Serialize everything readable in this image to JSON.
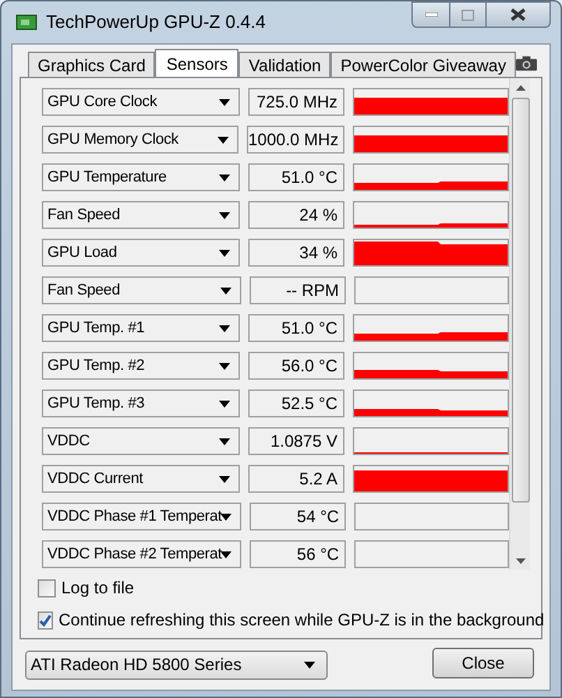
{
  "window": {
    "title": "TechPowerUp GPU-Z 0.4.4"
  },
  "tabs": [
    {
      "label": "Graphics Card",
      "selected": false
    },
    {
      "label": "Sensors",
      "selected": true
    },
    {
      "label": "Validation",
      "selected": false
    },
    {
      "label": "PowerColor Giveaway",
      "selected": false
    }
  ],
  "sensors": [
    {
      "name": "GPU Core Clock",
      "reading": "725.0 MHz"
    },
    {
      "name": "GPU Memory Clock",
      "reading": "1000.0 MHz"
    },
    {
      "name": "GPU Temperature",
      "reading": "51.0 °C"
    },
    {
      "name": "Fan Speed",
      "reading": "24 %"
    },
    {
      "name": "GPU Load",
      "reading": "34 %"
    },
    {
      "name": "Fan Speed",
      "reading": "-- RPM"
    },
    {
      "name": "GPU Temp. #1",
      "reading": "51.0 °C"
    },
    {
      "name": "GPU Temp. #2",
      "reading": "56.0 °C"
    },
    {
      "name": "GPU Temp. #3",
      "reading": "52.5 °C"
    },
    {
      "name": "VDDC",
      "reading": "1.0875 V"
    },
    {
      "name": "VDDC Current",
      "reading": "5.2 A"
    },
    {
      "name": "VDDC Phase #1 Temperat",
      "reading": "54 °C"
    },
    {
      "name": "VDDC Phase #2 Temperat",
      "reading": "56 °C"
    }
  ],
  "options": [
    {
      "label": "Log to file",
      "checked": false
    },
    {
      "label": "Continue refreshing this screen while GPU-Z is in the background",
      "checked": true
    }
  ],
  "device_select": {
    "value": "ATI Radeon HD 5800 Series"
  },
  "buttons": [
    "Close"
  ]
}
